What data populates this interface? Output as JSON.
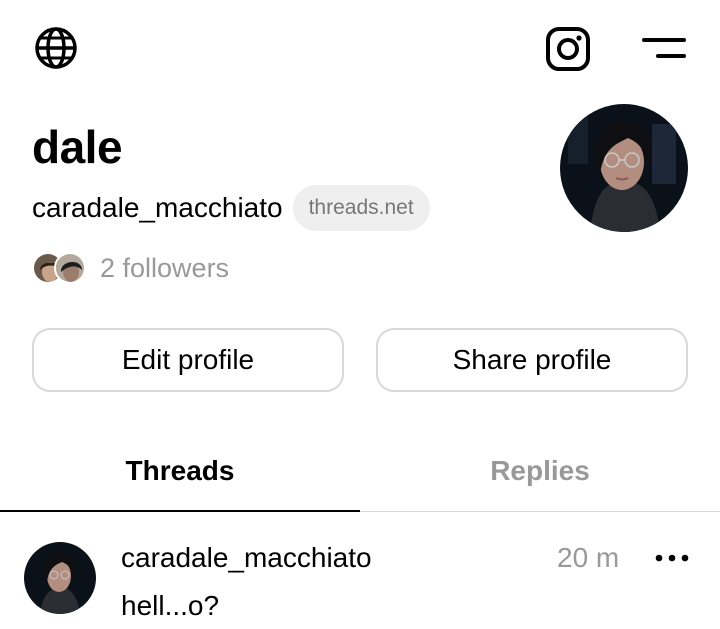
{
  "header": {
    "globe_icon": "globe-icon",
    "instagram_icon": "instagram-icon",
    "menu_icon": "menu-icon"
  },
  "profile": {
    "name": "dale",
    "handle": "caradale_macchiato",
    "domain": "threads.net",
    "followers_text": "2 followers"
  },
  "actions": {
    "edit_label": "Edit profile",
    "share_label": "Share profile"
  },
  "tabs": [
    {
      "label": "Threads",
      "active": true
    },
    {
      "label": "Replies",
      "active": false
    }
  ],
  "post": {
    "username": "caradale_macchiato",
    "time": "20 m",
    "text": "hell...o?",
    "more_icon": "more-icon"
  },
  "colors": {
    "text": "#000000",
    "muted": "#999999",
    "pill_bg": "#efefef",
    "border": "#d8d8d8"
  }
}
